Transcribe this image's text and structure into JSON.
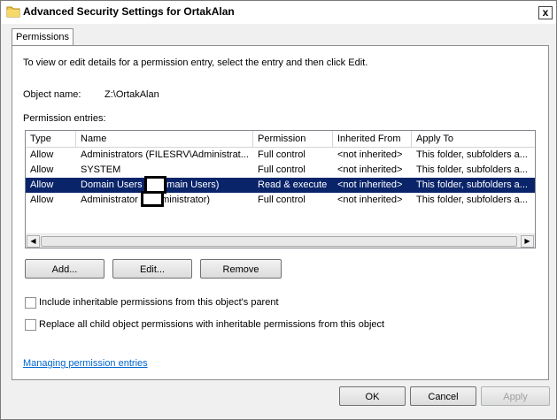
{
  "window": {
    "title": "Advanced Security Settings for OrtakAlan",
    "close_glyph": "x"
  },
  "tabs": [
    {
      "label": "Permissions"
    }
  ],
  "permissions": {
    "description": "To view or edit details for a permission entry, select the entry and then click Edit.",
    "object_name_label": "Object name:",
    "object_name_value": "Z:\\OrtakAlan",
    "entries_label": "Permission entries:",
    "columns": [
      "Type",
      "Name",
      "Permission",
      "Inherited From",
      "Apply To"
    ],
    "rows": [
      {
        "type": "Allow",
        "name": "Administrators (FILESRV\\Administrat...",
        "permission": "Full control",
        "inherited": "<not inherited>",
        "apply_to": "This folder, subfolders a..."
      },
      {
        "type": "Allow",
        "name": "SYSTEM",
        "permission": "Full control",
        "inherited": "<not inherited>",
        "apply_to": "This folder, subfolders a..."
      },
      {
        "type": "Allow",
        "name": "Domain Users (          (Domain Users)",
        "permission": "Read & execute",
        "inherited": "<not inherited>",
        "apply_to": "This folder, subfolders a..."
      },
      {
        "type": "Allow",
        "name": "Administrator (          \\Administrator)",
        "permission": "Full control",
        "inherited": "<not inherited>",
        "apply_to": "This folder, subfolders a..."
      }
    ],
    "selected_row": 2,
    "buttons": {
      "add": "Add...",
      "edit": "Edit...",
      "remove": "Remove"
    },
    "include_inheritable": {
      "label": "Include inheritable permissions from this object's parent",
      "checked": false
    },
    "replace_child": {
      "label": "Replace all child object permissions with inheritable permissions from this object",
      "checked": false
    },
    "help_link": "Managing permission entries"
  },
  "footer": {
    "ok": "OK",
    "cancel": "Cancel",
    "apply": "Apply"
  }
}
